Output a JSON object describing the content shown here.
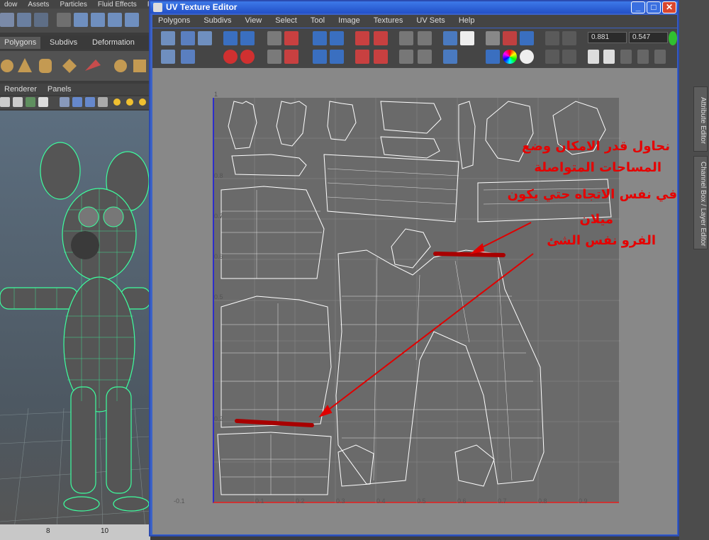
{
  "maya": {
    "menu": [
      "dow",
      "Assets",
      "Particles",
      "Fluid Effects",
      "Fl"
    ],
    "shelf_tabs": [
      "Polygons",
      "Subdivs",
      "Deformation"
    ],
    "panel_menu": [
      "Renderer",
      "Panels"
    ],
    "timeline_ticks": [
      "8",
      "10"
    ]
  },
  "uv_editor": {
    "title": "UV Texture Editor",
    "menu": [
      "Polygons",
      "Subdivs",
      "View",
      "Select",
      "Tool",
      "Image",
      "Textures",
      "UV Sets",
      "Help"
    ],
    "field_u": "0.881",
    "field_v": "0.547",
    "v_ticks": [
      "1",
      "0.8",
      "0.7",
      "0.6",
      "0.5",
      "0.2"
    ],
    "u_ticks": [
      "-0.1",
      "0.1",
      "0.2",
      "0.3",
      "0.4",
      "0.5",
      "0.6",
      "0.7",
      "0.8",
      "0.9"
    ]
  },
  "side_tabs": {
    "attribute_editor": "Attribute Editor",
    "channel_box": "Channel Box / Layer Editor"
  },
  "annotation": {
    "line1": "نحاول قدر الامكان وضع",
    "line2": "المساحات المتواصلة",
    "line3": "في نفس الاتجاه حتي يكون",
    "line4": "ميلان",
    "line5": "الفرو نفس الشئ"
  },
  "colors": {
    "title_bar": "#2350c8",
    "annotation": "#e60000",
    "wireframe": "#3dff9e",
    "uv_lines": "#ffffff"
  }
}
